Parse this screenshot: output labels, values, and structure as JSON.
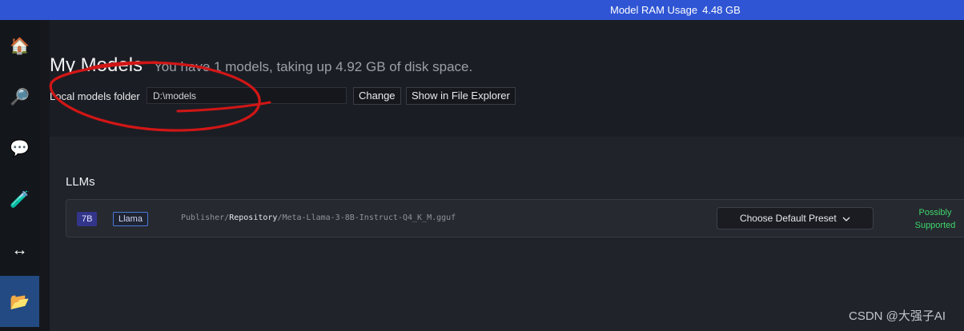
{
  "topbar": {
    "ram_label": "Model RAM Usage",
    "ram_value": "4.48 GB"
  },
  "sidebar": {
    "items": [
      {
        "icon": "🏠",
        "name": "home"
      },
      {
        "icon": "🔎",
        "name": "search"
      },
      {
        "icon": "💬",
        "name": "chat"
      },
      {
        "icon": "🧪",
        "name": "playground"
      },
      {
        "icon": "↔",
        "name": "server"
      },
      {
        "icon": "📂",
        "name": "my-models"
      }
    ]
  },
  "main": {
    "title": "My Models",
    "subtitle": "You have 1 models, taking up 4.92 GB of disk space.",
    "folder_label": "Local models folder",
    "folder_value": "D:\\models",
    "change_label": "Change",
    "explorer_label": "Show in File Explorer"
  },
  "llms": {
    "heading": "LLMs",
    "models": [
      {
        "size": "7B",
        "arch": "Llama",
        "publisher": "Publisher/",
        "repository": "Repository",
        "file": "/Meta-Llama-3-8B-Instruct-Q4_K_M.gguf",
        "preset_label": "Choose Default Preset",
        "support_line1": "Possibly",
        "support_line2": "Supported"
      }
    ]
  },
  "watermark": "CSDN @大强子AI",
  "colors": {
    "accent": "#2f55d4",
    "active_nav": "#234a82",
    "supported": "#3ed66b",
    "annotation": "#d11616"
  }
}
